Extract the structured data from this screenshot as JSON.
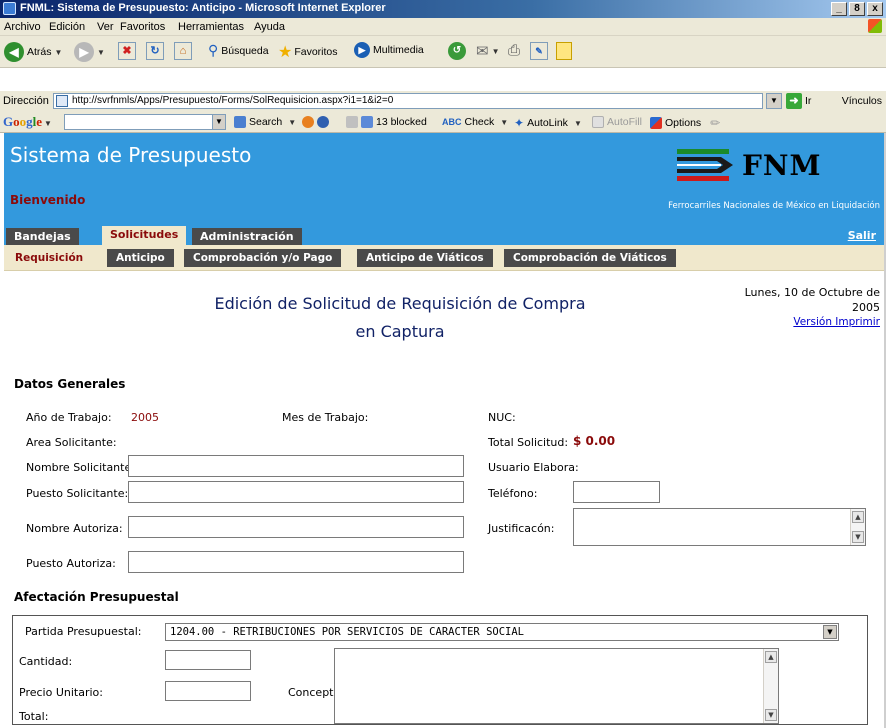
{
  "window": {
    "title": "FNML: Sistema de Presupuesto: Anticipo - Microsoft Internet Explorer",
    "buttons": [
      "_",
      "8",
      "x"
    ]
  },
  "menu": [
    "Archivo",
    "Edición",
    "Ver",
    "Favoritos",
    "Herramientas",
    "Ayuda"
  ],
  "toolbar": {
    "back_label": "Atrás",
    "search_label": "Búsqueda",
    "favorites_label": "Favoritos",
    "multimedia_label": "Multimedia"
  },
  "address": {
    "label": "Dirección",
    "url": "http://svrfnmls/Apps/Presupuesto/Forms/SolRequisicion.aspx?i1=1&i2=0",
    "go_label": "Ir",
    "links_label": "Vínculos"
  },
  "googlebar": {
    "logo": "Google",
    "search_label": "Search",
    "blocked_label": "13 blocked",
    "check_label": "Check",
    "autolink_label": "AutoLink",
    "autofill_label": "AutoFill",
    "options_label": "Options"
  },
  "header": {
    "title": "Sistema de Presupuesto",
    "welcome": "Bienvenido",
    "logo_text": "FNM",
    "org_name": "Ferrocarriles Nacionales de México en Liquidación"
  },
  "colors": {
    "header_blue": "#3399dd",
    "accent_red": "#8a0a0a",
    "tab_dark": "#4a4a4a",
    "tab_cream": "#f0e8cc"
  },
  "nav": {
    "tabs": [
      "Bandejas",
      "Solicitudes",
      "Administración"
    ],
    "active_tab": "Solicitudes",
    "logout": "Salir",
    "subtabs": [
      "Requisición",
      "Anticipo",
      "Comprobación y/o Pago",
      "Anticipo de Viáticos",
      "Comprobación de Viáticos"
    ],
    "active_subtab": "Requisición"
  },
  "page": {
    "heading_line1": "Edición de Solicitud de Requisición de Compra",
    "heading_line2": "en Captura",
    "date_line1": "Lunes, 10 de Octubre de",
    "date_line2": "2005",
    "print_link": "Versión Imprimir"
  },
  "general": {
    "section_title": "Datos Generales",
    "year_label": "Año de Trabajo:",
    "year_value": "2005",
    "month_label": "Mes de Trabajo:",
    "nuc_label": "NUC:",
    "area_label": "Area Solicitante:",
    "total_label": "Total Solicitud:",
    "total_value": "$ 0.00",
    "requester_name_label": "Nombre Solicitante:",
    "created_by_label": "Usuario Elabora:",
    "requester_post_label": "Puesto Solicitante:",
    "phone_label": "Teléfono:",
    "authorizer_name_label": "Nombre Autoriza:",
    "justification_label": "Justificacón:",
    "authorizer_post_label": "Puesto Autoriza:"
  },
  "budget": {
    "section_title": "Afectación Presupuestal",
    "item_label": "Partida Presupuestal:",
    "item_value": "1204.00 - RETRIBUCIONES POR SERVICIOS DE CARACTER SOCIAL",
    "quantity_label": "Cantidad:",
    "unit_price_label": "Precio Unitario:",
    "concept_label": "Concepto:",
    "total_label": "Total:"
  }
}
